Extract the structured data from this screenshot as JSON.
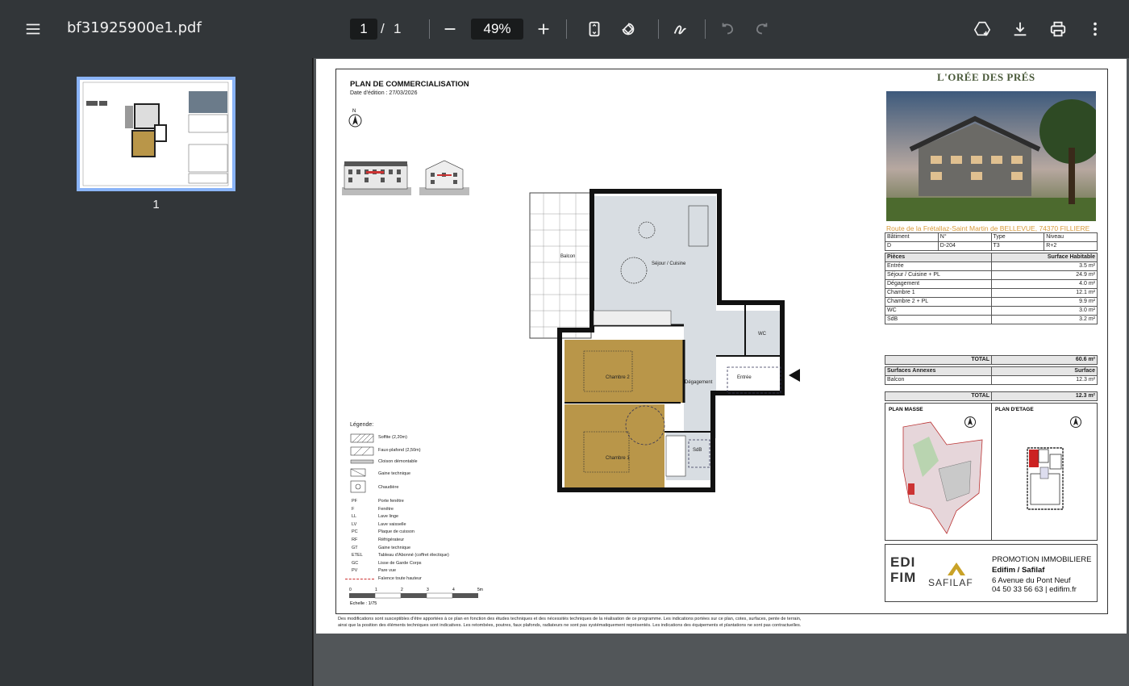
{
  "toolbar": {
    "filename": "bf31925900e1.pdf",
    "page_current": "1",
    "page_sep": "/",
    "page_total": "1",
    "zoom": "49%"
  },
  "sidebar": {
    "thumb_label": "1"
  },
  "doc": {
    "plan_title": "PLAN DE COMMERCIALISATION",
    "edit_date": "Date d'édition :  27/03/2026",
    "north": "N",
    "brand": "L'ORÉE DES PRÉS",
    "address": "Route de la Frétallaz-Saint Martin de BELLEVUE, 74370 FILLIERE",
    "info_headers": [
      "Bâtiment",
      "N°",
      "Type",
      "Niveau"
    ],
    "info_values": [
      "D",
      "D-204",
      "T3",
      "R+2"
    ],
    "rooms_header": [
      "Pièces",
      "Surface Habitable"
    ],
    "rooms": [
      [
        "Entrée",
        "3.5 m²"
      ],
      [
        "Séjour / Cuisine + PL",
        "24.9 m²"
      ],
      [
        "Dégagement",
        "4.0 m²"
      ],
      [
        "Chambre 1",
        "12.1 m²"
      ],
      [
        "Chambre 2 + PL",
        "9.9 m²"
      ],
      [
        "WC",
        "3.0 m²"
      ],
      [
        "SdB",
        "3.2 m²"
      ]
    ],
    "total_label": "TOTAL",
    "total_value": "60.6 m²",
    "annex_header": [
      "Surfaces Annexes",
      "Surface"
    ],
    "annex": [
      [
        "Balcon",
        "12.3 m²"
      ]
    ],
    "annex_total_label": "TOTAL",
    "annex_total_value": "12.3 m²",
    "plan_masse": "PLAN MASSE",
    "plan_etage": "PLAN D'ETAGE",
    "promo_title": "PROMOTION IMMOBILIERE",
    "promo_name": "Edifim / Safilaf",
    "promo_address": "6 Avenue du Pont Neuf",
    "promo_contact": "04 50 33 56 63 | edifim.fr",
    "logo_edifim": "EDI FIM",
    "logo_safilaf": "SAFILAF",
    "legend_title": "Légende:",
    "legend_items": [
      "Soffite (2,20m)",
      "Faux-plafond (2,50m)",
      "Cloison démontable",
      "Gaine technique",
      "Chaudière"
    ],
    "abbr": [
      [
        "PF",
        "Porte fenêtre"
      ],
      [
        "F",
        "Fenêtre"
      ],
      [
        "LL",
        "Lave linge"
      ],
      [
        "LV",
        "Lave vaisselle"
      ],
      [
        "PC",
        "Plaque de cuisson"
      ],
      [
        "RF",
        "Réfrigérateur"
      ],
      [
        "GT",
        "Gaine technique"
      ],
      [
        "ETEL",
        "Tableau d'Abonné (coffret électique)"
      ],
      [
        "GC",
        "Lisse de Garde Corps"
      ],
      [
        "PV",
        "Pare vue"
      ],
      [
        "",
        "Faïence toute hauteur"
      ]
    ],
    "scale_ticks": [
      "0",
      "1",
      "2",
      "3",
      "4",
      "5m"
    ],
    "scale_label": "Echelle : 1/75",
    "room_labels": {
      "balcon": "Balcon",
      "sejour": "Séjour / Cuisine",
      "chambre2": "Chambre 2",
      "chambre1": "Chambre 1",
      "degagement": "Dégagement",
      "entree": "Entrée",
      "wc": "WC",
      "sdb": "SdB"
    },
    "footer_line1": "Des modifications sont susceptibles d'être apportées à ce plan en fonction des études techniques et des nécessités techniques de la réalisation de ce programme.   Les indications portées sur ce plan, cotes, surfaces, pente de terrain,",
    "footer_line2": "ainsi que la position des éléments techniques sont indicatives.  Les retombées, poutres, faux plafonds, radiateurs ne sont pas systématiquement représentés. Les indications des équipements et plantations ne sont pas contractuelles."
  },
  "colors": {
    "toolbar_bg": "#323639",
    "viewer_bg": "#525659",
    "thumb_selected": "#8ab4f8",
    "brand_green": "#4a5a3a",
    "address_orange": "#d99a3a",
    "bedroom_fill": "#b99649",
    "living_fill": "#d8dde2"
  }
}
